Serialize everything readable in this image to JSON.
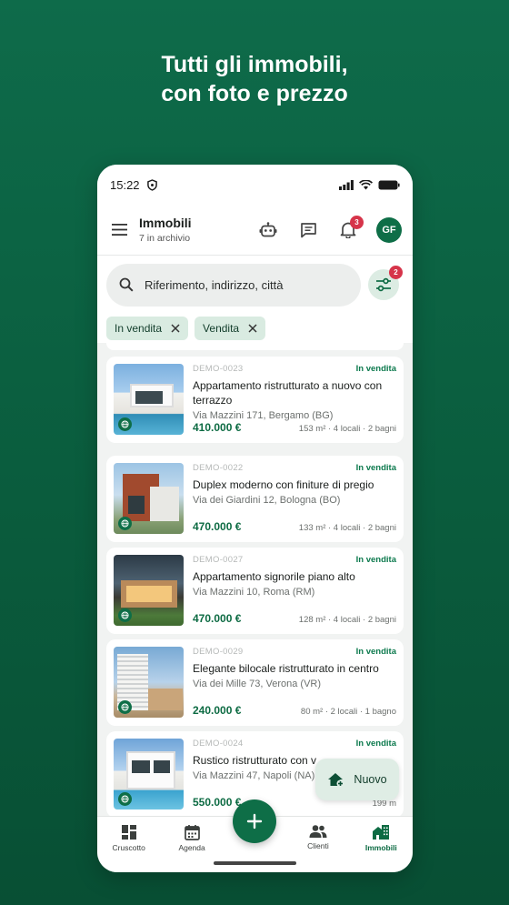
{
  "headline": {
    "line1": "Tutti gli immobili,",
    "line2": "con foto e prezzo"
  },
  "status_bar": {
    "time": "15:22"
  },
  "app_bar": {
    "title": "Immobili",
    "subtitle": "7 in archivio",
    "notifications_count": "3",
    "avatar_initials": "GF"
  },
  "search": {
    "placeholder": "Riferimento, indirizzo, città",
    "filter_count": "2"
  },
  "chips": [
    {
      "label": "In vendita"
    },
    {
      "label": "Vendita"
    }
  ],
  "listings": [
    {
      "ref": "DEMO-0023",
      "status": "In vendita",
      "title": "Appartamento ristrutturato a nuovo con terrazzo",
      "address": "Via Mazzini 171, Bergamo (BG)",
      "price": "410.000 €",
      "specs": "153 m² · 4 locali · 2 bagni"
    },
    {
      "ref": "DEMO-0022",
      "status": "In vendita",
      "title": "Duplex moderno con finiture di pregio",
      "address": "Via dei Giardini 12, Bologna (BO)",
      "price": "470.000 €",
      "specs": "133 m² · 4 locali · 2 bagni"
    },
    {
      "ref": "DEMO-0027",
      "status": "In vendita",
      "title": "Appartamento signorile piano alto",
      "address": "Via Mazzini 10, Roma (RM)",
      "price": "470.000 €",
      "specs": "128 m² · 4 locali · 2 bagni"
    },
    {
      "ref": "DEMO-0029",
      "status": "In vendita",
      "title": "Elegante bilocale ristrutturato in centro",
      "address": "Via dei Mille 73, Verona (VR)",
      "price": "240.000 €",
      "specs": "80 m² · 2 locali · 1 bagno"
    },
    {
      "ref": "DEMO-0024",
      "status": "In vendita",
      "title": "Rustico ristrutturato con v",
      "address": "Via Mazzini 47, Napoli (NA)",
      "price": "550.000 €",
      "specs": "199 m"
    }
  ],
  "fab_new": {
    "label": "Nuovo"
  },
  "nav": [
    {
      "label": "Cruscotto"
    },
    {
      "label": "Agenda"
    },
    {
      "label": "Clienti"
    },
    {
      "label": "Immobili"
    }
  ],
  "colors": {
    "brand_green": "#0e6e47",
    "badge_red": "#d6344a",
    "chip_bg": "#d9ebe1"
  }
}
